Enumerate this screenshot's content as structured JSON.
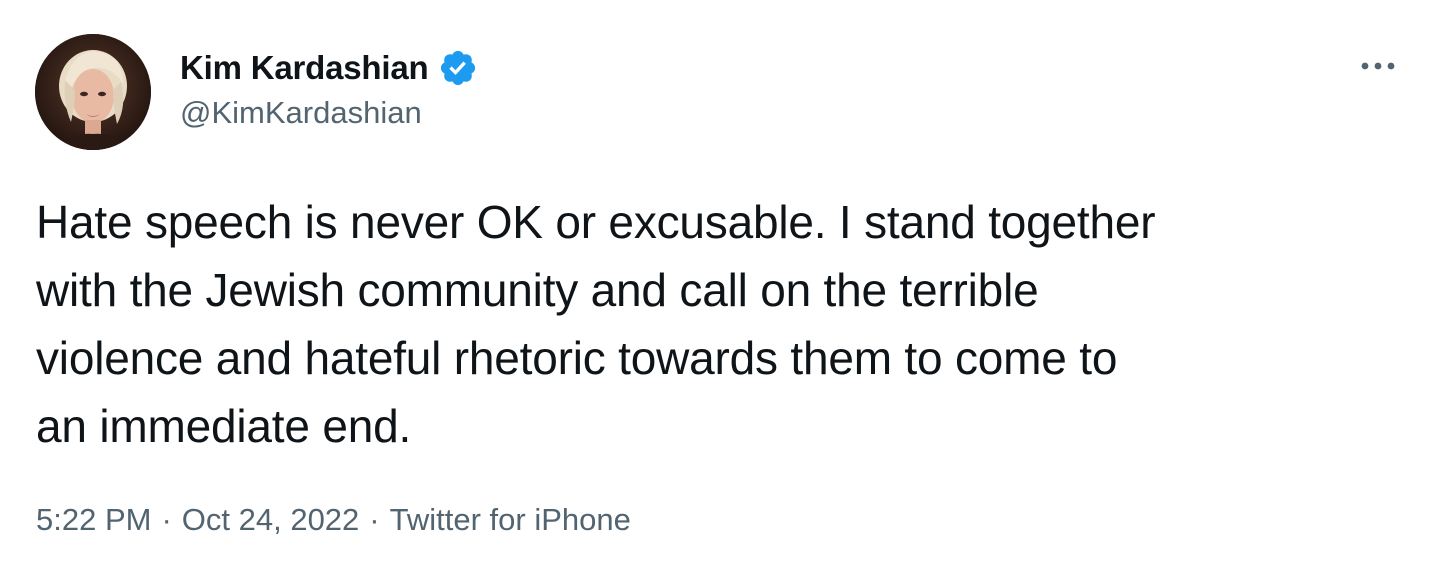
{
  "tweet": {
    "author": {
      "display_name": "Kim Kardashian",
      "handle": "@KimKardashian",
      "verified_icon": "verified-badge-icon",
      "avatar_icon": "avatar"
    },
    "more_icon": "more-options-icon",
    "text": "Hate speech is never OK or excusable. I stand together\nwith the Jewish community and call on the terrible\nviolence and hateful rhetoric towards them to come to\nan immediate end.",
    "time": "5:22 PM",
    "separator": "·",
    "date": "Oct 24, 2022",
    "source": "Twitter for iPhone"
  },
  "colors": {
    "text": "#0f1419",
    "secondary": "#536471",
    "verified": "#1d9bf0",
    "background": "#ffffff"
  }
}
